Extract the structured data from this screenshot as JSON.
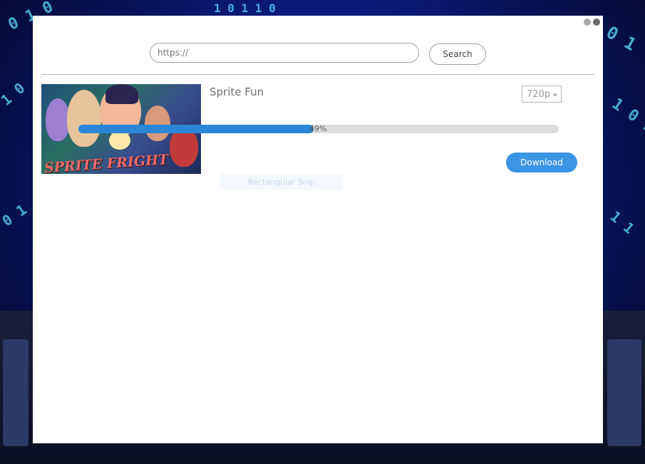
{
  "window_controls": {
    "minimize_icon": "circle",
    "close_icon": "circle"
  },
  "search": {
    "placeholder": "https://",
    "value": "",
    "button_label": "Search"
  },
  "video": {
    "title": "Sprite Fun",
    "thumbnail_text": "SPRITE FRIGHT",
    "quality": "720p",
    "progress_label": "49%",
    "progress_fraction": 0.49,
    "download_label": "Download"
  },
  "overlay": {
    "snip_label": "Rectangular Snip"
  },
  "colors": {
    "accent": "#3b95e4",
    "progress": "#2a86d6",
    "track": "#dddddd"
  }
}
